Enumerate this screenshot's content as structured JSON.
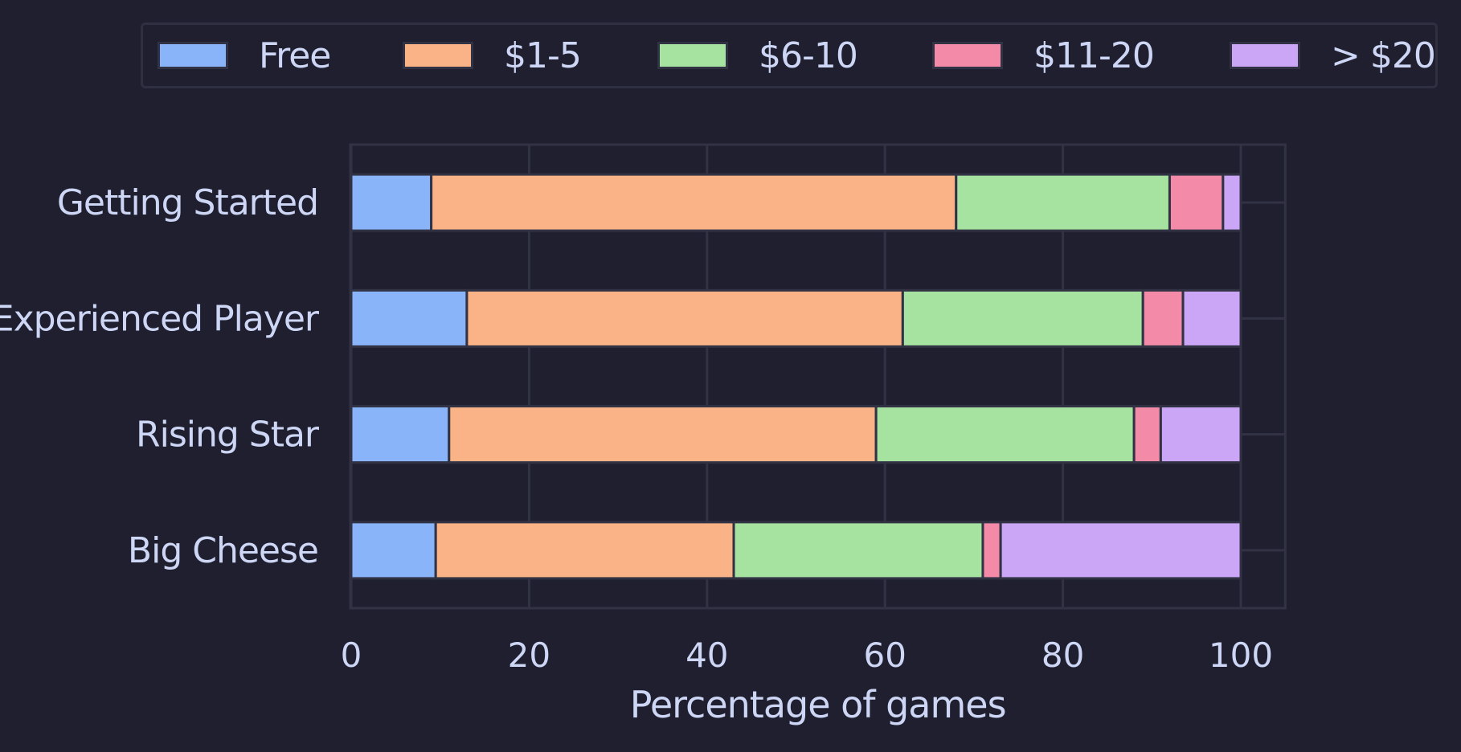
{
  "chart_data": {
    "type": "bar",
    "orientation": "horizontal",
    "stacked": true,
    "title": "",
    "xlabel": "Percentage of games",
    "ylabel": "",
    "xlim": [
      0,
      105
    ],
    "xticks": [
      0,
      20,
      40,
      60,
      80,
      100
    ],
    "categories": [
      "Getting Started",
      "Experienced Player",
      "Rising Star",
      "Big Cheese"
    ],
    "series": [
      {
        "name": "Free",
        "color": "#89b4fa",
        "values": [
          9,
          13,
          11,
          9.5
        ]
      },
      {
        "name": "$1-5",
        "color": "#fab387",
        "values": [
          59,
          49,
          48,
          33.5
        ]
      },
      {
        "name": "$6-10",
        "color": "#a6e3a1",
        "values": [
          24,
          27,
          29,
          28
        ]
      },
      {
        "name": "$11-20",
        "color": "#f38ba8",
        "values": [
          6,
          4.5,
          3,
          2
        ]
      },
      {
        "name": "> $20",
        "color": "#cba6f7",
        "values": [
          2,
          6.5,
          9,
          27
        ]
      }
    ],
    "grid": true,
    "legend_position": "top"
  },
  "colors": {
    "background": "#1f1f2f",
    "grid": "#313244",
    "text": "#cdd6f4"
  }
}
